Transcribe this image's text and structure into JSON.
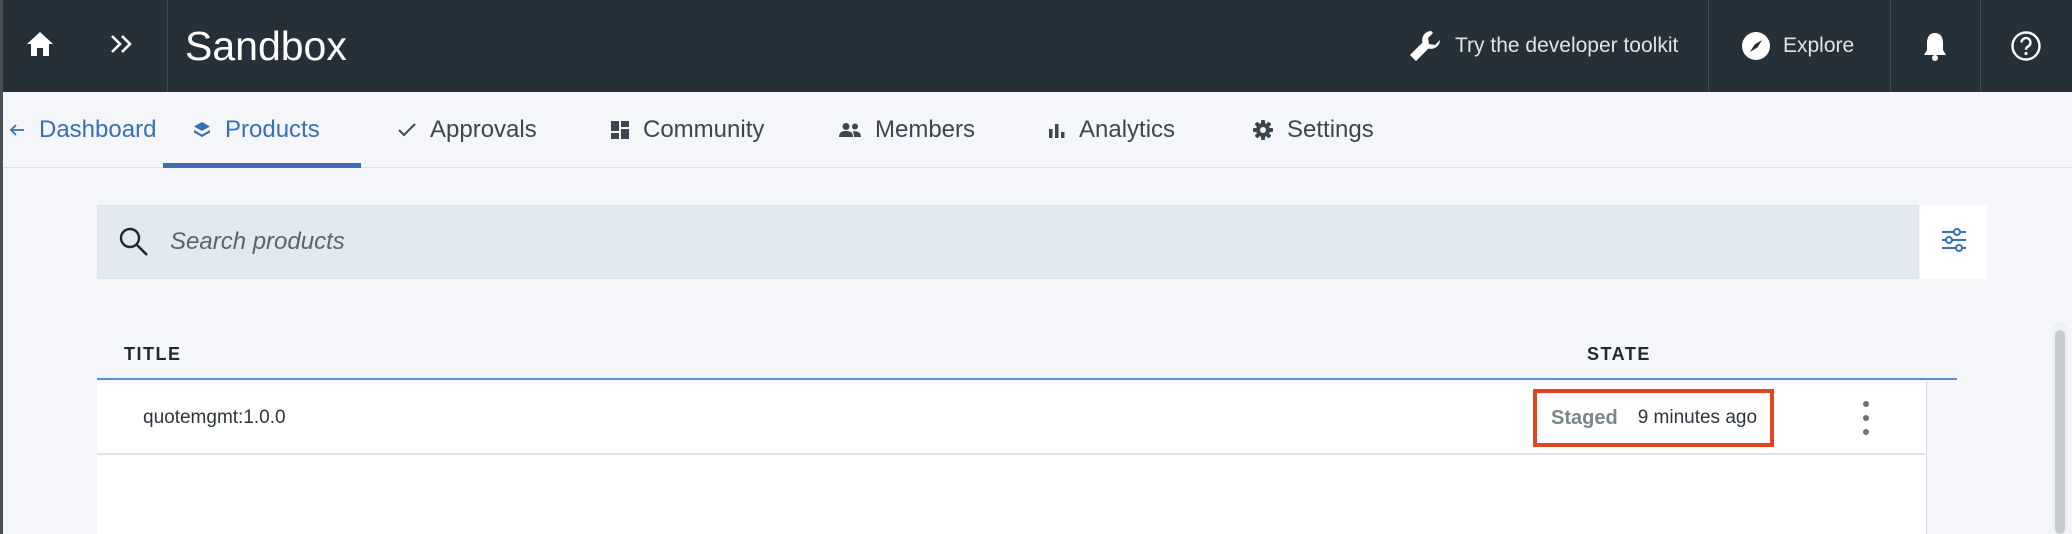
{
  "topbar": {
    "title": "Sandbox",
    "toolkit_label": "Try the developer toolkit",
    "explore_label": "Explore",
    "icons": {
      "home": "home-icon",
      "expand": "double-chevron-right-icon",
      "toolkit": "wrench-icon",
      "explore": "compass-icon",
      "notifications": "bell-icon",
      "help": "help-icon"
    }
  },
  "tabs": [
    {
      "label": "Dashboard",
      "icon": "arrow-left-icon",
      "active": false
    },
    {
      "label": "Products",
      "icon": "layers-icon",
      "active": true
    },
    {
      "label": "Approvals",
      "icon": "checkmark-icon",
      "active": false
    },
    {
      "label": "Community",
      "icon": "dashboard-tiles-icon",
      "active": false
    },
    {
      "label": "Members",
      "icon": "people-icon",
      "active": false
    },
    {
      "label": "Analytics",
      "icon": "bar-chart-icon",
      "active": false
    },
    {
      "label": "Settings",
      "icon": "gear-icon",
      "active": false
    }
  ],
  "search": {
    "placeholder": "Search products",
    "value": ""
  },
  "table": {
    "columns": [
      "TITLE",
      "STATE"
    ],
    "rows": [
      {
        "title": "quotemgmt:1.0.0",
        "state": "Staged",
        "updated": "9 minutes ago"
      }
    ]
  },
  "colors": {
    "topbar_bg": "#253039",
    "accent": "#3a6fb8",
    "highlight_border": "#e0461f",
    "page_bg": "#f4f6f9"
  }
}
